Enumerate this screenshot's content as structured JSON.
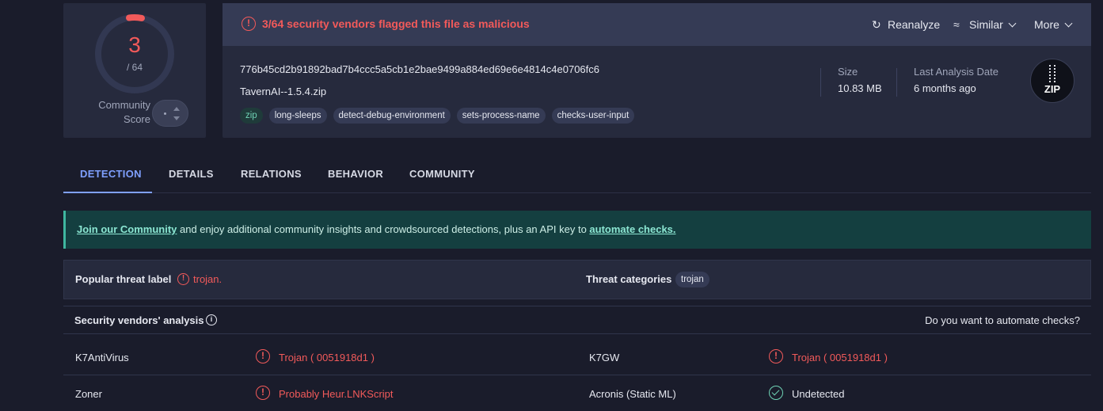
{
  "score": {
    "detected": "3",
    "total": "/ 64",
    "community_label": "Community Score"
  },
  "summary": {
    "flag_text": "3/64 security vendors flagged this file as malicious",
    "reanalyze": "Reanalyze",
    "similar": "Similar",
    "more": "More",
    "hash": "776b45cd2b91892bad7b4ccc5a5cb1e2bae9499a884ed69e6e4814c4e0706fc6",
    "filename": "TavernAI--1.5.4.zip",
    "tags": [
      "zip",
      "long-sleeps",
      "detect-debug-environment",
      "sets-process-name",
      "checks-user-input"
    ],
    "size_label": "Size",
    "size_value": "10.83 MB",
    "date_label": "Last Analysis Date",
    "date_value": "6 months ago",
    "file_type": "ZIP"
  },
  "tabs": [
    "DETECTION",
    "DETAILS",
    "RELATIONS",
    "BEHAVIOR",
    "COMMUNITY"
  ],
  "banner": {
    "link1": "Join our Community",
    "middle": " and enjoy additional community insights and crowdsourced detections, plus an API key to ",
    "link2": "automate checks."
  },
  "threat": {
    "label": "Popular threat label",
    "value": "trojan.",
    "categories_label": "Threat categories",
    "category": "trojan"
  },
  "vendors": {
    "title": "Security vendors' analysis",
    "automate_question": "Do you want to automate checks?",
    "rows": [
      {
        "left_name": "K7AntiVirus",
        "left_result": "Trojan ( 0051918d1 )",
        "right_name": "K7GW",
        "right_result": "Trojan ( 0051918d1 )"
      },
      {
        "left_name": "Zoner",
        "left_result": "Probably Heur.LNKScript",
        "right_name": "Acronis (Static ML)",
        "right_result": "Undetected"
      }
    ]
  },
  "colors": {
    "accent": "#7fa0ff",
    "danger": "#f25a5a",
    "success": "#6fd3b5",
    "bg": "#1a1c2b",
    "card": "#262a3d"
  }
}
